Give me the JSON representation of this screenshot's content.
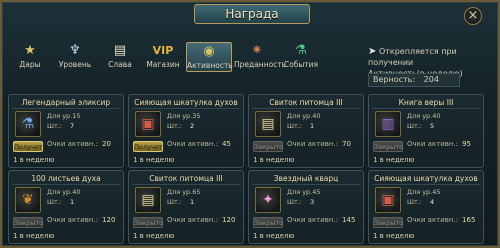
{
  "window": {
    "title": "Награда",
    "close_symbol": "×"
  },
  "tabs": [
    {
      "label": "Дары",
      "icon": "star-icon",
      "glyph": "★",
      "color": "#d8c46a"
    },
    {
      "label": "Уровень",
      "icon": "wings-icon",
      "glyph": "♆",
      "color": "#c6d7e8"
    },
    {
      "label": "Слава",
      "icon": "scroll-icon",
      "glyph": "▤",
      "color": "#e8e1c4"
    },
    {
      "label": "Магазин",
      "icon": "vip-icon",
      "glyph": "VIP",
      "color": "#e4b340"
    },
    {
      "label": "Активность",
      "icon": "eye-icon",
      "glyph": "◉",
      "color": "#d8c46a"
    },
    {
      "label": "Преданность",
      "icon": "gear-icon",
      "glyph": "✷",
      "color": "#d47a55"
    },
    {
      "label": "События",
      "icon": "potion-icon",
      "glyph": "⚗",
      "color": "#55c08b"
    }
  ],
  "note": {
    "line1": "Открепляется при получении",
    "line2_prefix": "Активность(в нед",
    "line2_highlight": "ел",
    "line2_suffix": "ю)"
  },
  "loyalty": {
    "label": "Верность:",
    "value": "204"
  },
  "cards": [
    {
      "title": "Легендарный эликсир",
      "icon": "elixir-icon",
      "glyph": "⚗",
      "glyph_color": "#6aa7e8",
      "level_label": "Для ур.15",
      "qty_label": "Шт.:",
      "qty": "7",
      "points_label": "Очки активн.:",
      "points": "20",
      "button": "Получить",
      "button_state": "get",
      "limit": "1 в неделю"
    },
    {
      "title": "Сияющая шкатулка духов",
      "icon": "chest-icon",
      "glyph": "▣",
      "glyph_color": "#d25c48",
      "level_label": "Для ур.35",
      "qty_label": "Шт.:",
      "qty": "2",
      "points_label": "Очки активн.:",
      "points": "45",
      "button": "Получить",
      "button_state": "get",
      "limit": "1 в неделю"
    },
    {
      "title": "Свиток питомца III",
      "icon": "scroll-icon",
      "glyph": "▤",
      "glyph_color": "#e3d29a",
      "level_label": "Для ур.40",
      "qty_label": "Шт.:",
      "qty": "1",
      "points_label": "Очки активн.:",
      "points": "70",
      "button": "Закрыто",
      "button_state": "closed",
      "limit": "1 в неделю"
    },
    {
      "title": "Книга веры III",
      "icon": "book-icon",
      "glyph": "▥",
      "glyph_color": "#9b6ad6",
      "level_label": "Для ур.40",
      "qty_label": "Шт.:",
      "qty": "5",
      "points_label": "Очки активн.:",
      "points": "95",
      "button": "Закрыто",
      "button_state": "closed",
      "limit": "1 в неделю"
    },
    {
      "title": "100 листьев духа",
      "icon": "leaves-icon",
      "glyph": "❦",
      "glyph_color": "#d98b2f",
      "level_label": "Для ур.40",
      "qty_label": "Шт.:",
      "qty": "1",
      "points_label": "Очки активн.:",
      "points": "120",
      "button": "Закрыто",
      "button_state": "closed",
      "limit": "1 в неделю"
    },
    {
      "title": "Свиток питомца III",
      "icon": "scroll-icon",
      "glyph": "▤",
      "glyph_color": "#e3d29a",
      "level_label": "Для ур.65",
      "qty_label": "Шт.:",
      "qty": "1",
      "points_label": "Очки активн.:",
      "points": "120",
      "button": "Закрыто",
      "button_state": "closed",
      "limit": "1 в неделю"
    },
    {
      "title": "Звездный кварц",
      "icon": "crystal-icon",
      "glyph": "✦",
      "glyph_color": "#ef9bd6",
      "level_label": "Для ур.45",
      "qty_label": "Шт.:",
      "qty": "3",
      "points_label": "Очки активн.:",
      "points": "145",
      "button": "Закрыто",
      "button_state": "closed",
      "limit": "1 в неделю"
    },
    {
      "title": "Сияющая шкатулка духов",
      "icon": "chest-icon",
      "glyph": "▣",
      "glyph_color": "#d25c48",
      "level_label": "Для ур.45",
      "qty_label": "Шт.:",
      "qty": "4",
      "points_label": "Очки активн.:",
      "points": "165",
      "button": "Закрыто",
      "button_state": "closed",
      "limit": "1 в неделю"
    }
  ]
}
